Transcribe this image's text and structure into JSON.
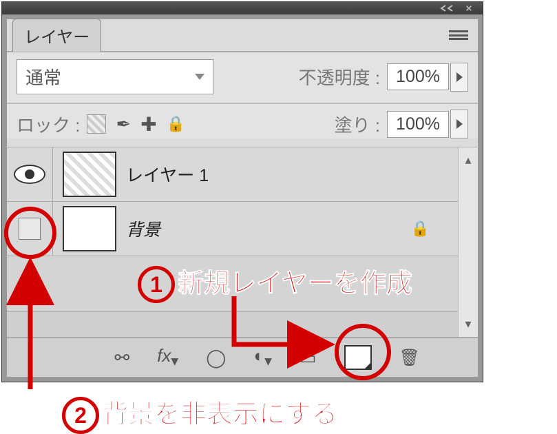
{
  "tab_title": "レイヤー",
  "blend_mode": "通常",
  "opacity_label": "不透明度 :",
  "opacity_value": "100%",
  "lock_label": "ロック :",
  "fill_label": "塗り :",
  "fill_value": "100%",
  "layers": [
    {
      "name": "レイヤー 1",
      "visible": true,
      "locked": false,
      "thumb": "checker"
    },
    {
      "name": "背景",
      "visible": false,
      "locked": true,
      "thumb": "white"
    }
  ],
  "annotations": {
    "a1": "新規レイヤーを作成",
    "a2": "背景を非表示にする"
  }
}
